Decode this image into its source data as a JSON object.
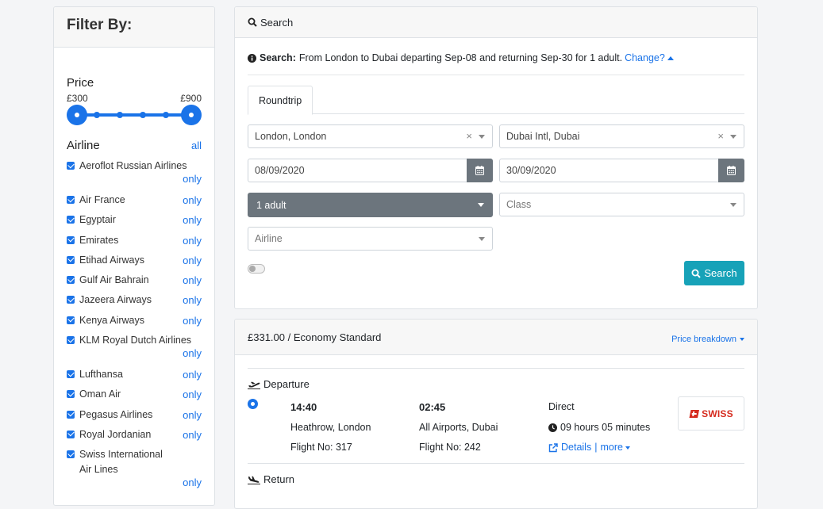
{
  "sidebar": {
    "title": "Filter By:",
    "price": {
      "title": "Price",
      "min": "£300",
      "max": "£900"
    },
    "airline": {
      "title": "Airline",
      "all_label": "all",
      "only_label": "only",
      "items": [
        "Aeroflot Russian Airlines",
        "Air France",
        "Egyptair",
        "Emirates",
        "Etihad Airways",
        "Gulf Air Bahrain",
        "Jazeera Airways",
        "Kenya Airways",
        "KLM Royal Dutch Airlines",
        "Lufthansa",
        "Oman Air",
        "Pegasus Airlines",
        "Royal Jordanian",
        "Swiss International Air Lines"
      ]
    }
  },
  "search": {
    "header": "Search",
    "info_label": "Search:",
    "info_text": "From London to Dubai departing Sep-08 and returning Sep-30 for 1 adult.",
    "change_label": "Change?",
    "tab_label": "Roundtrip",
    "from_value": "London, London",
    "to_value": "Dubai Intl, Dubai",
    "depart_date": "08/09/2020",
    "return_date": "30/09/2020",
    "passengers": "1 adult",
    "class_placeholder": "Class",
    "airline_placeholder": "Airline",
    "button_label": "Search"
  },
  "result": {
    "price_text": "£331.00 / Economy Standard",
    "breakdown_label": "Price breakdown",
    "departure": {
      "title": "Departure",
      "depart_time": "14:40",
      "depart_airport": "Heathrow, London",
      "depart_flight": "Flight No: 317",
      "arrive_time": "02:45",
      "arrive_airport": "All Airports, Dubai",
      "arrive_flight": "Flight No: 242",
      "stops": "Direct",
      "duration": "09 hours 05 minutes",
      "details_label": "Details",
      "more_label": "more",
      "airline_logo_text": "SWISS"
    },
    "return": {
      "title": "Return"
    }
  },
  "colors": {
    "accent": "#1a73e8",
    "search_button": "#17a2b8",
    "grey_button": "#6c757d",
    "logo_red": "#d52b1e"
  }
}
